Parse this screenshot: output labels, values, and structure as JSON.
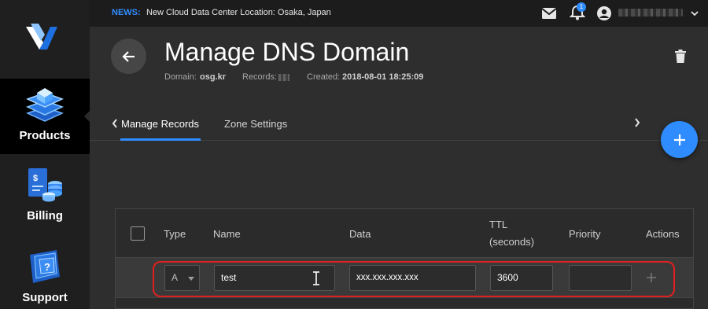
{
  "sidebar": {
    "items": [
      {
        "label": "Products",
        "icon": "products-icon",
        "active": true
      },
      {
        "label": "Billing",
        "icon": "billing-icon",
        "active": false
      },
      {
        "label": "Support",
        "icon": "support-icon",
        "active": false
      }
    ]
  },
  "topbar": {
    "news_label": "NEWS:",
    "news_text": "New Cloud Data Center Location: Osaka, Japan",
    "notification_count": "1"
  },
  "header": {
    "title": "Manage DNS Domain",
    "domain_label": "Domain:",
    "domain_value": "osg.kr",
    "records_label": "Records:",
    "created_label": "Created:",
    "created_value": "2018-08-01 18:25:09"
  },
  "tabs": [
    {
      "label": "Manage Records",
      "active": true
    },
    {
      "label": "Zone Settings",
      "active": false
    }
  ],
  "table": {
    "columns": [
      "Type",
      "Name",
      "Data",
      "TTL",
      "(seconds)",
      "Priority",
      "Actions"
    ],
    "row": {
      "type": "A",
      "name": "test",
      "data": "xxx.xxx.xxx.xxx",
      "ttl": "3600",
      "priority": ""
    }
  },
  "colors": {
    "accent": "#2f8cff",
    "highlight": "#e02020"
  }
}
